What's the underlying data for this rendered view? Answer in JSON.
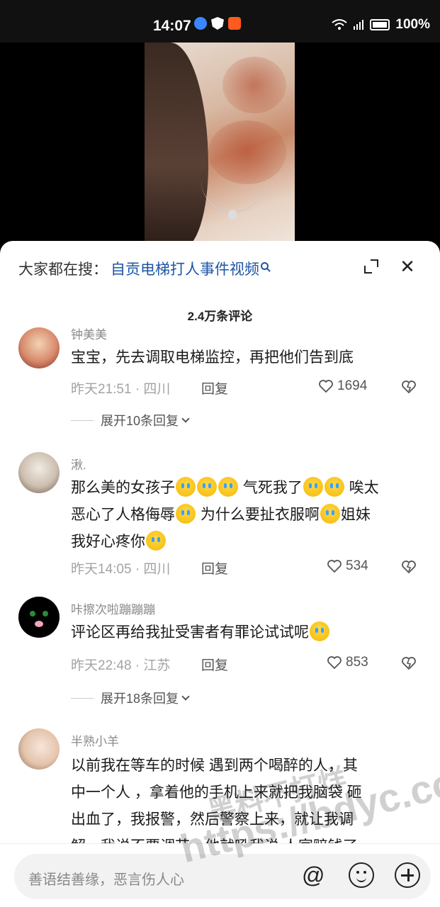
{
  "status_bar": {
    "time": "14:07",
    "battery": "100%"
  },
  "search": {
    "label": "大家都在搜：",
    "query": "自贡电梯打人事件视频"
  },
  "comments_count": "2.4万条评论",
  "comments": [
    {
      "username": "钟美美",
      "text": "宝宝，先去调取电梯监控，再把他们告到底",
      "meta": "昨天21:51 · 四川",
      "reply": "回复",
      "likes": "1694",
      "expand": "展开10条回复"
    },
    {
      "username": "湫.",
      "text_line1": "那么美的女孩子",
      "text_line1b": " 气死我了",
      "text_line1c": " 唉太",
      "text_line2": "恶心了人格侮辱",
      "text_line2b": " 为什么要扯衣服啊",
      "text_line2c": "姐妹",
      "text_line3": "我好心疼你",
      "meta": "昨天14:05 · 四川",
      "reply": "回复",
      "likes": "534"
    },
    {
      "username": "咔擦次啦蹦蹦蹦",
      "text": "评论区再给我扯受害者有罪论试试呢",
      "meta": "昨天22:48 · 江苏",
      "reply": "回复",
      "likes": "853",
      "expand": "展开18条回复"
    },
    {
      "username": "半熟小羊",
      "text_line1": "以前我在等车的时候  遇到两个喝醉的人，其",
      "text_line2": "中一个人 ，拿着他的手机上来就把我脑袋  砸",
      "text_line3": "出血了，我报警，然后警察上来，就让我调",
      "text_line4": "解，我说不要调节，他就吼我说  人家赔钱了，"
    }
  ],
  "input": {
    "placeholder": "善语结善缘，恶言伤人心"
  },
  "watermark": {
    "text": "https://bdyc.co",
    "text_cn": "黑料不打烊"
  }
}
